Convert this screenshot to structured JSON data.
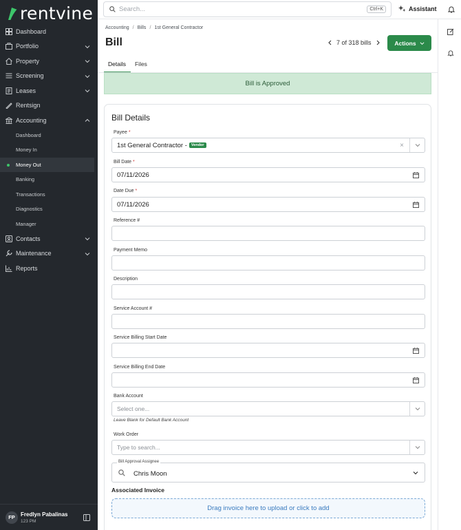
{
  "brand": {
    "name": "rentvine",
    "accent": "#2b8a4a"
  },
  "sidebar": {
    "items": [
      {
        "label": "Dashboard",
        "icon": "dashboard-icon"
      },
      {
        "label": "Portfolio",
        "icon": "portfolio-icon"
      },
      {
        "label": "Property",
        "icon": "property-icon"
      },
      {
        "label": "Screening",
        "icon": "screening-icon"
      },
      {
        "label": "Leases",
        "icon": "leases-icon"
      },
      {
        "label": "Rentsign",
        "icon": "rentsign-icon"
      },
      {
        "label": "Accounting",
        "icon": "accounting-icon"
      },
      {
        "label": "Contacts",
        "icon": "contacts-icon"
      },
      {
        "label": "Maintenance",
        "icon": "maintenance-icon"
      },
      {
        "label": "Reports",
        "icon": "reports-icon"
      }
    ],
    "accounting_sub": [
      "Dashboard",
      "Money In",
      "Money Out",
      "Banking",
      "Transactions",
      "Diagnostics",
      "Manager"
    ],
    "user": {
      "initials": "FP",
      "name": "Fredlyn Pabalinas",
      "status": "123 PM"
    }
  },
  "topbar": {
    "search_placeholder": "Search...",
    "shortcut": "Ctrl+K",
    "assistant_label": "Assistant"
  },
  "page": {
    "breadcrumb": [
      "Accounting",
      "Bills",
      "1st General Contractor"
    ],
    "title": "Bill",
    "pager": "7 of 318 bills",
    "actions_label": "Actions",
    "tabs": [
      "Details",
      "Files"
    ],
    "banner": "Bill is Approved"
  },
  "form": {
    "title": "Bill Details",
    "payee": {
      "label": "Payee",
      "value": "1st General Contractor -",
      "badge": "Vendor"
    },
    "bill_date": {
      "label": "Bill Date",
      "value": "07/11/2026"
    },
    "date_due": {
      "label": "Date Due",
      "value": "07/11/2026"
    },
    "reference": {
      "label": "Reference #"
    },
    "payment_memo": {
      "label": "Payment Memo"
    },
    "description": {
      "label": "Description"
    },
    "service_account": {
      "label": "Service Account #"
    },
    "service_start": {
      "label": "Service Billing Start Date"
    },
    "service_end": {
      "label": "Service Billing End Date"
    },
    "bank_account": {
      "label": "Bank Account",
      "placeholder": "Select one...",
      "hint": "Leave Blank for Default Bank Account"
    },
    "work_order": {
      "label": "Work Order",
      "placeholder": "Type to search..."
    },
    "assignee": {
      "label": "Bill Approval Assignee",
      "value": "Chris Moon"
    },
    "associated_invoice": {
      "label": "Associated Invoice",
      "dropzone": "Drag invoice here to upload or click to add"
    }
  }
}
